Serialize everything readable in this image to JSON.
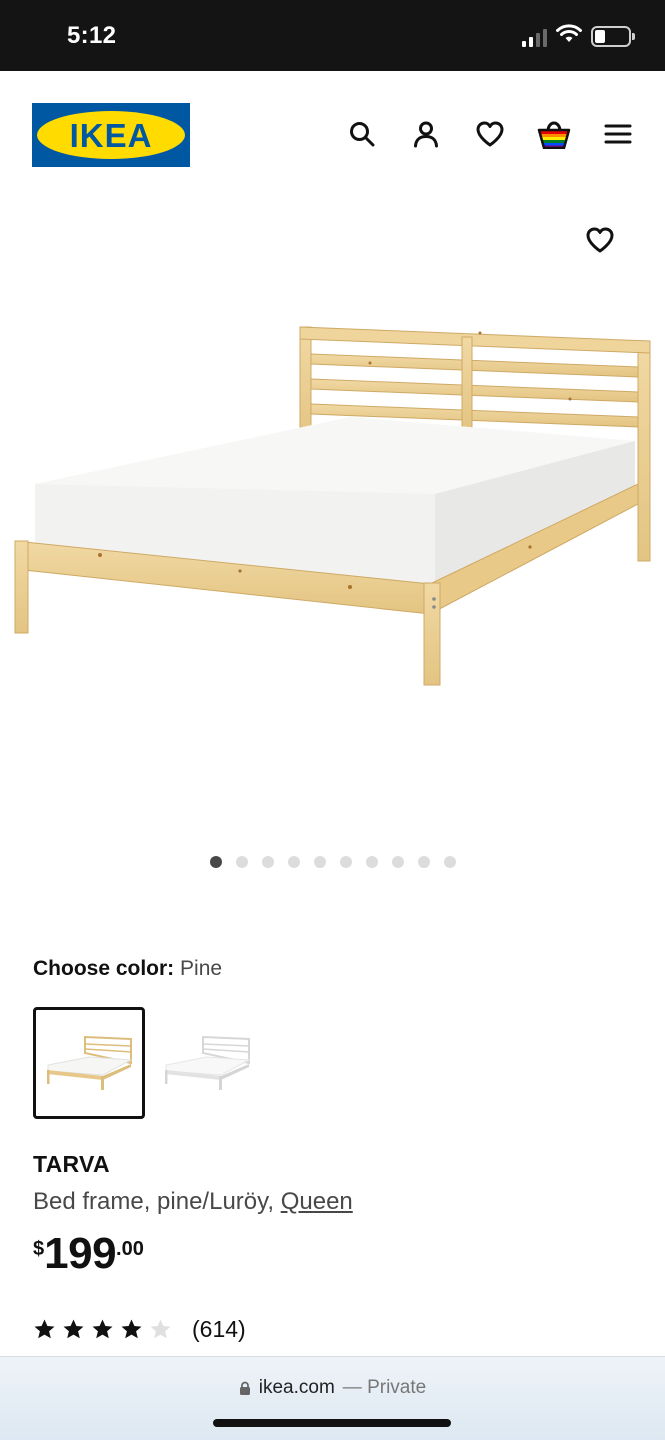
{
  "status_bar": {
    "time": "5:12"
  },
  "header": {
    "logo_text": "IKEA",
    "icons": [
      "search-icon",
      "account-icon",
      "heart-icon",
      "basket-icon",
      "menu-icon"
    ]
  },
  "gallery": {
    "image_count": 10,
    "active_index": 0
  },
  "color_chooser": {
    "label": "Choose color:",
    "selected_value": "Pine",
    "options": [
      "pine",
      "white"
    ]
  },
  "product": {
    "name": "TARVA",
    "description": "Bed frame, pine/Luröy,",
    "size_link": "Queen",
    "price_currency": "$",
    "price_integer": "199",
    "price_decimal": ".00",
    "rating": 4,
    "rating_max": 5,
    "reviews": "(614)"
  },
  "browser": {
    "domain": "ikea.com",
    "mode": "— Private"
  },
  "colors": {
    "status_bar_bg": "#141414",
    "ikea_blue": "#0058a3",
    "ikea_yellow": "#ffdb00",
    "wood": "#eccf93",
    "text_primary": "#111111",
    "text_secondary": "#484848"
  }
}
